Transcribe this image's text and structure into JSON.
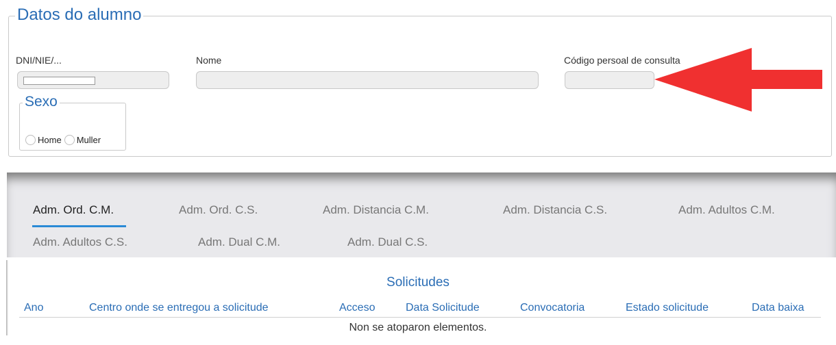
{
  "alumno": {
    "legend": "Datos do alumno",
    "dni_label": "DNI/NIE/...",
    "nome_label": "Nome",
    "codigo_label": "Código persoal de consulta",
    "sexo": {
      "legend": "Sexo",
      "options": [
        "Home",
        "Muller"
      ]
    }
  },
  "annotation": {
    "arrow_color": "#f03030"
  },
  "tabs": [
    {
      "label": "Adm. Ord. C.M.",
      "active": true
    },
    {
      "label": "Adm. Ord. C.S.",
      "active": false
    },
    {
      "label": "Adm. Distancia C.M.",
      "active": false
    },
    {
      "label": "Adm. Distancia C.S.",
      "active": false
    },
    {
      "label": "Adm. Adultos C.M.",
      "active": false
    },
    {
      "label": "Adm. Adultos C.S.",
      "active": false
    },
    {
      "label": "Adm. Dual C.M.",
      "active": false
    },
    {
      "label": "Adm. Dual C.S.",
      "active": false
    }
  ],
  "solicitudes": {
    "title": "Solicitudes",
    "columns": [
      "Ano",
      "Centro onde se entregou a solicitude",
      "Acceso",
      "Data Solicitude",
      "Convocatoria",
      "Estado solicitude",
      "Data baixa"
    ],
    "empty_message": "Non se atoparon elementos."
  },
  "colors": {
    "accent": "#2a6db5",
    "tab_underline": "#2a8ad6"
  }
}
